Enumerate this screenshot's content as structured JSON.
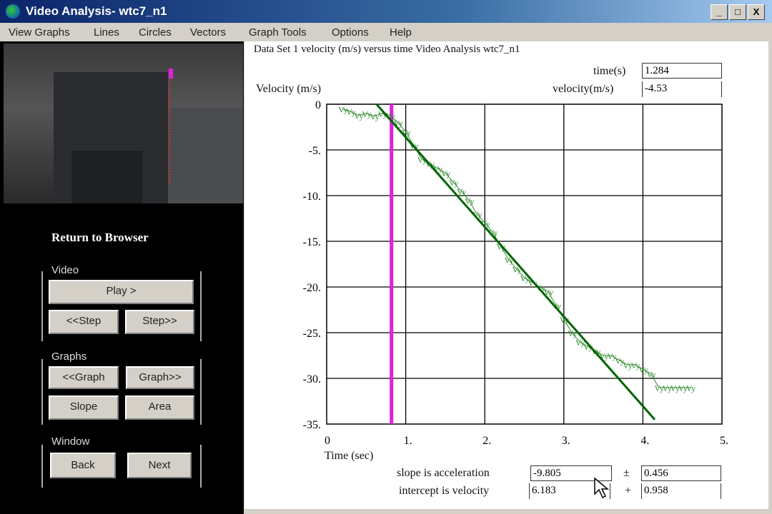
{
  "window": {
    "title": "Video Analysis- wtc7_n1",
    "minimize": "_",
    "maximize": "□",
    "close": "X"
  },
  "menu": [
    "View Graphs",
    "Lines",
    "Circles",
    "Vectors",
    "Graph Tools",
    "Options",
    "Help"
  ],
  "left": {
    "return_label": "Return to Browser",
    "video_group": "Video",
    "play": "Play >",
    "step_back": "<<Step",
    "step_fwd": "Step>>",
    "graphs_group": "Graphs",
    "graph_back": "<<Graph",
    "graph_fwd": "Graph>>",
    "slope": "Slope",
    "area": "Area",
    "window_group": "Window",
    "back": "Back",
    "next": "Next"
  },
  "readout": {
    "header": "Data Set 1 velocity (m/s) versus time   Video Analysis wtc7_n1",
    "time_label": "time(s)",
    "time_value": "1.284",
    "velocity_label": "velocity(m/s)",
    "velocity_value": "-4.53"
  },
  "fit": {
    "slope_label": "slope is acceleration",
    "slope_value": "-9.805",
    "slope_pm": "±",
    "slope_err": "0.456",
    "intercept_label": "intercept is velocity",
    "intercept_value": "6.183",
    "intercept_pm": "+",
    "intercept_err": "0.958"
  },
  "colors": {
    "data": "#2e8b2e",
    "fit": "#006400",
    "cursor": "#e020e0"
  },
  "chart_data": {
    "type": "scatter",
    "ylabel": "Velocity (m/s)",
    "xlabel": "Time (sec)",
    "xlim": [
      0,
      5
    ],
    "ylim": [
      -35,
      0
    ],
    "xticks": [
      "0",
      "1.",
      "2.",
      "3.",
      "4.",
      "5."
    ],
    "yticks": [
      "0",
      "-5.",
      "-10.",
      "-15.",
      "-20.",
      "-25.",
      "-30.",
      "-35."
    ],
    "point_label": "Vy",
    "cursor_t": 0.82,
    "fit_line": {
      "slope": -9.805,
      "intercept": 6.183,
      "t_range": [
        0.63,
        4.15
      ]
    },
    "t": [
      0.2,
      0.3,
      0.4,
      0.5,
      0.6,
      0.7,
      0.8,
      0.9,
      1.0,
      1.1,
      1.2,
      1.3,
      1.4,
      1.5,
      1.6,
      1.7,
      1.8,
      1.9,
      2.0,
      2.1,
      2.2,
      2.3,
      2.4,
      2.5,
      2.6,
      2.7,
      2.8,
      2.9,
      3.0,
      3.1,
      3.2,
      3.3,
      3.4,
      3.5,
      3.6,
      3.7,
      3.8,
      3.9,
      4.0,
      4.1,
      4.2,
      4.3,
      4.4,
      4.5,
      4.6
    ],
    "v": [
      -0.5,
      -0.8,
      -1.2,
      -1.0,
      -1.3,
      -1.0,
      -1.2,
      -2,
      -3,
      -4.5,
      -6,
      -6.5,
      -7,
      -7.5,
      -8.5,
      -9.5,
      -10.5,
      -12,
      -13,
      -14,
      -15.5,
      -17,
      -18,
      -19,
      -19.5,
      -20,
      -20.5,
      -22,
      -23.5,
      -25,
      -26,
      -26.5,
      -27,
      -27.5,
      -27.5,
      -28,
      -28.5,
      -28.5,
      -29,
      -29.5,
      -31,
      -31,
      -31,
      -31,
      -31
    ]
  }
}
